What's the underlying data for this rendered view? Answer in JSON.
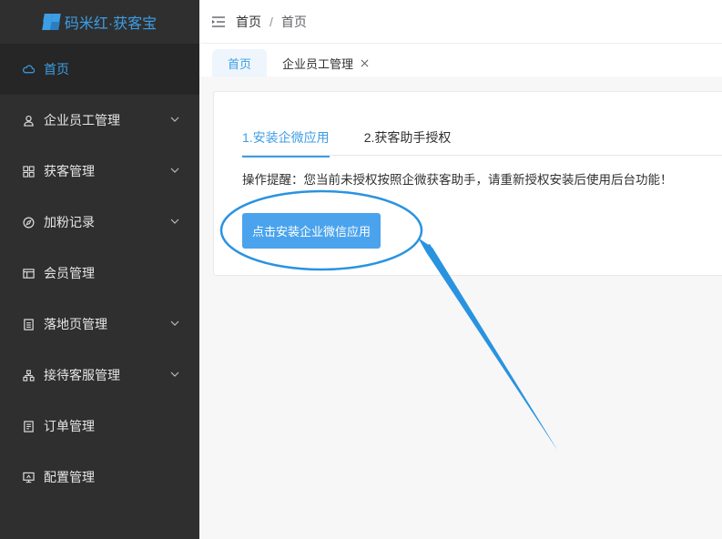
{
  "app": {
    "title": "码米红·获客宝"
  },
  "sidebar": {
    "items": [
      {
        "label": "首页",
        "icon": "cloud-icon",
        "active": true,
        "expandable": false
      },
      {
        "label": "企业员工管理",
        "icon": "user-icon",
        "active": false,
        "expandable": true
      },
      {
        "label": "获客管理",
        "icon": "grid-icon",
        "active": false,
        "expandable": true
      },
      {
        "label": "加粉记录",
        "icon": "compass-icon",
        "active": false,
        "expandable": true
      },
      {
        "label": "会员管理",
        "icon": "member-card-icon",
        "active": false,
        "expandable": false
      },
      {
        "label": "落地页管理",
        "icon": "list-icon",
        "active": false,
        "expandable": true
      },
      {
        "label": "接待客服管理",
        "icon": "org-chart-icon",
        "active": false,
        "expandable": true
      },
      {
        "label": "订单管理",
        "icon": "document-icon",
        "active": false,
        "expandable": false
      },
      {
        "label": "配置管理",
        "icon": "monitor-icon",
        "active": false,
        "expandable": false
      }
    ]
  },
  "header": {
    "breadcrumb": [
      "首页",
      "首页"
    ],
    "separator": "/"
  },
  "tabs": [
    {
      "label": "首页",
      "active": true,
      "closable": false
    },
    {
      "label": "企业员工管理",
      "active": false,
      "closable": true
    }
  ],
  "steps": [
    {
      "label": "1.安装企微应用",
      "active": true
    },
    {
      "label": "2.获客助手授权",
      "active": false
    }
  ],
  "notice": "操作提醒：您当前未授权按照企微获客助手，请重新授权安装后使用后台功能！",
  "install_button": "点击安装企业微信应用",
  "colors": {
    "accent": "#3d9ee6",
    "sidebar_bg": "#2f2f2f",
    "button": "#4aa3ec"
  }
}
